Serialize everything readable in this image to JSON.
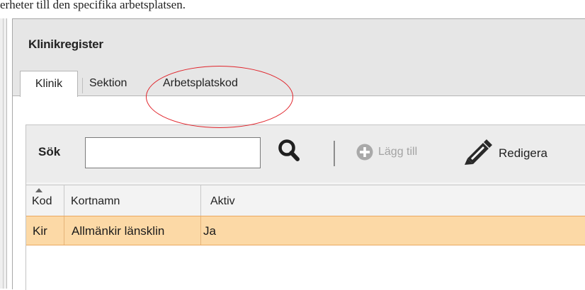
{
  "caption": "erheter till den specifika arbetsplatsen.",
  "window": {
    "title": "Klinikregister"
  },
  "tabs": [
    {
      "label": "Klinik",
      "selected": true
    },
    {
      "label": "Sektion",
      "selected": false
    },
    {
      "label": "Arbetsplatskod",
      "selected": false
    }
  ],
  "annotation": {
    "shape": "ellipse",
    "color": "#e0242b",
    "highlights": "Arbetsplatskod"
  },
  "toolbar": {
    "search_label": "Sök",
    "search_value": "",
    "search_icon": "magnifier-icon",
    "add_label": "Lägg till",
    "add_icon": "plus-circle-icon",
    "add_enabled": false,
    "edit_label": "Redigera",
    "edit_icon": "pencil-icon"
  },
  "grid": {
    "columns": [
      "Kod",
      "Kortnamn",
      "Aktiv"
    ],
    "sort_column": "Kod",
    "sort_direction": "ascending",
    "rows": [
      {
        "kod": "Kir",
        "kortnamn": "Allmänkir länsklin",
        "aktiv": "Ja",
        "selected": true
      }
    ]
  },
  "colors": {
    "chrome": "#e6e6e6",
    "selected_row": "#fcd9a6",
    "selected_row_border": "#eaa860",
    "annotation": "#e0242b"
  }
}
